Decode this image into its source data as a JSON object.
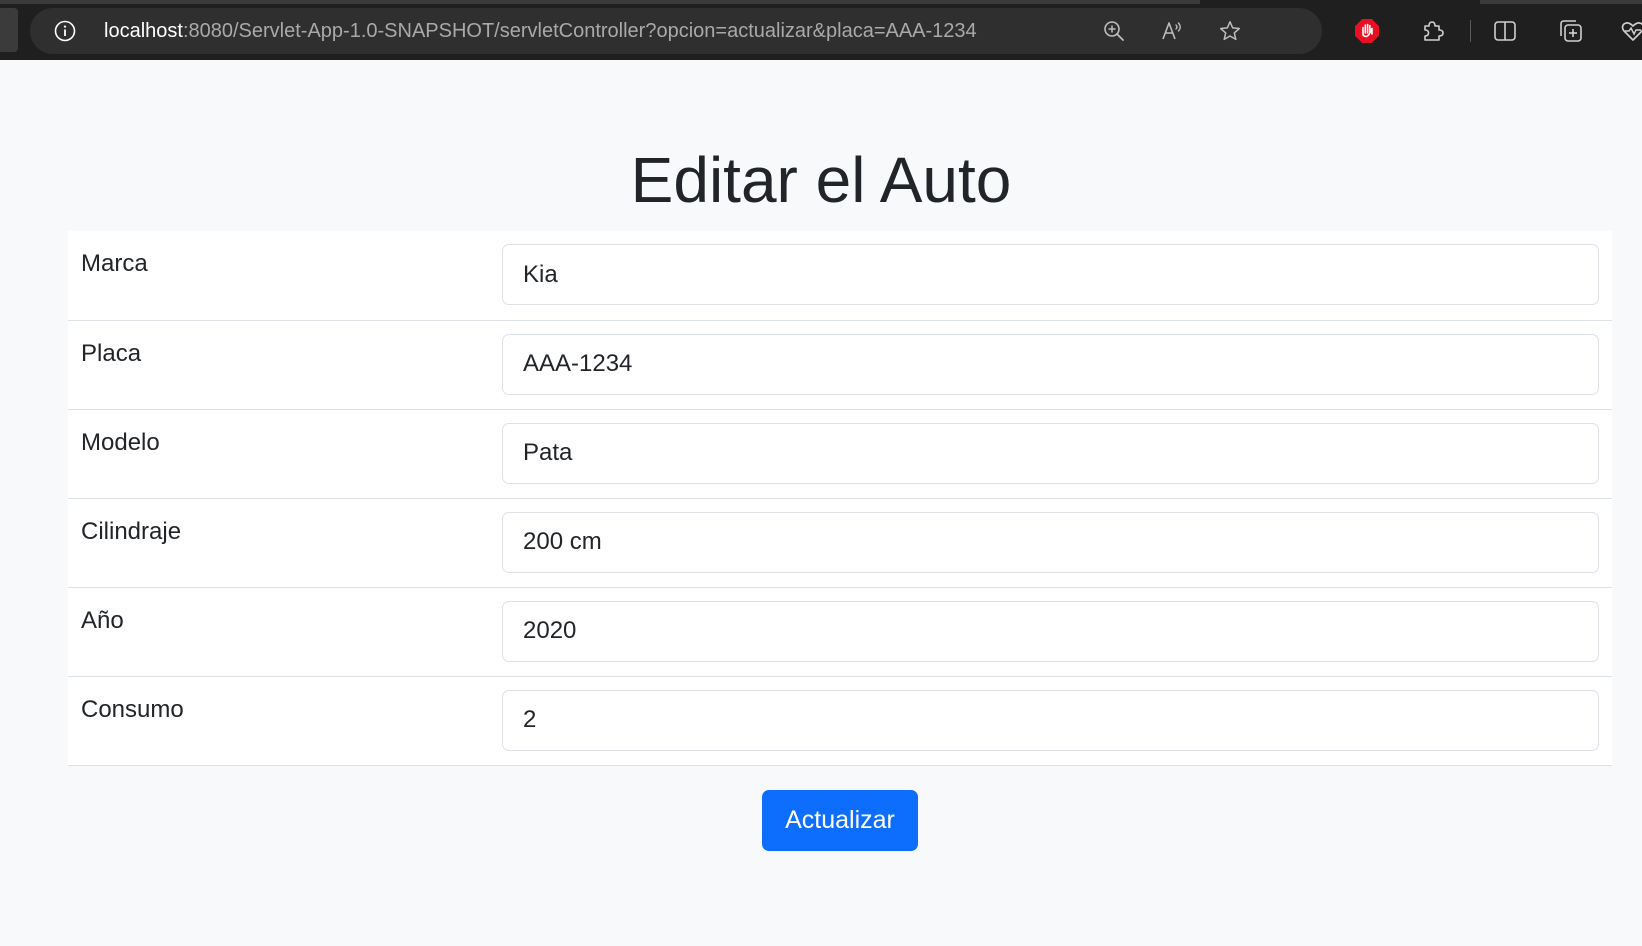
{
  "browser": {
    "url_host": "localhost",
    "url_rest": ":8080/Servlet-App-1.0-SNAPSHOT/servletController?opcion=actualizar&placa=AAA-1234",
    "icons": {
      "site_info": "info-icon",
      "zoom": "zoom-in-icon",
      "read_aloud": "read-aloud-icon",
      "favorite": "star-icon",
      "extension_stop": "stop-hand-icon",
      "extensions": "puzzle-icon",
      "split_screen": "split-screen-icon",
      "collections": "collections-icon",
      "performance": "heart-pulse-icon"
    },
    "colors": {
      "chrome_bg": "#1f1f1f",
      "address_bar_bg": "#2f2f2f",
      "stop_icon": "#e81123"
    }
  },
  "page": {
    "title": "Editar el Auto",
    "fields": [
      {
        "label": "Marca",
        "value": "Kia"
      },
      {
        "label": "Placa",
        "value": "AAA-1234"
      },
      {
        "label": "Modelo",
        "value": "Pata"
      },
      {
        "label": "Cilindraje",
        "value": "200 cm"
      },
      {
        "label": "Año",
        "value": "2020"
      },
      {
        "label": "Consumo",
        "value": "2"
      }
    ],
    "submit_label": "Actualizar",
    "colors": {
      "background": "#f8f9fa",
      "primary": "#0d6efd",
      "text": "#212529"
    }
  }
}
